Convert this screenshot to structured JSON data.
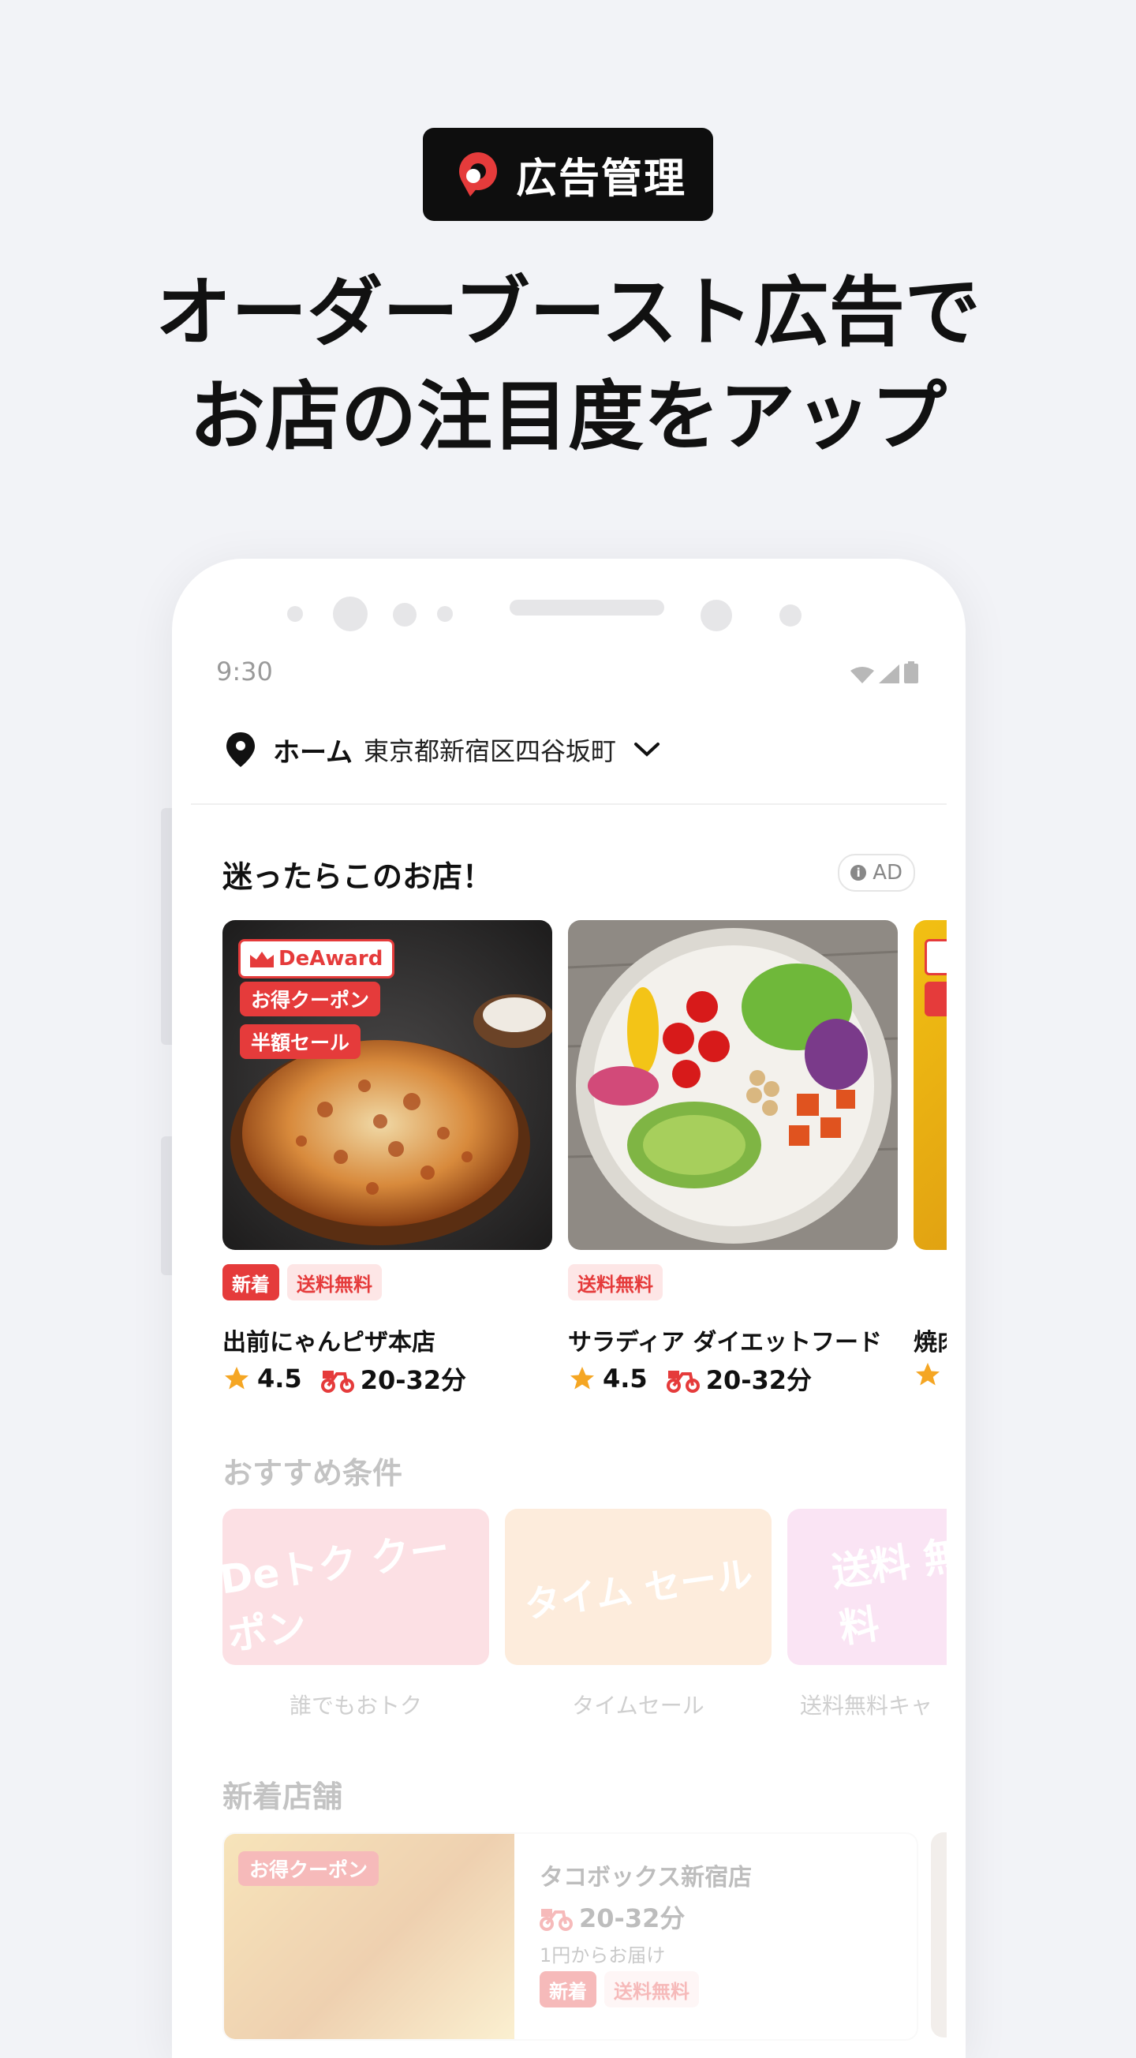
{
  "badge": {
    "label": "広告管理"
  },
  "headline": {
    "line1": "オーダーブースト広告で",
    "line2": "お店の注目度をアップ"
  },
  "status": {
    "time": "9:30"
  },
  "address": {
    "home": "ホーム",
    "text": "東京都新宿区四谷坂町"
  },
  "featured": {
    "title": "迷ったらこのお店！",
    "ad_label": "AD",
    "cards": [
      {
        "award": "DeAward",
        "tags": [
          "お得クーポン",
          "半額セール"
        ],
        "chips": [
          "新着",
          "送料無料"
        ],
        "name": "出前にゃんピザ本店",
        "rating": "4.5",
        "time": "20-32分"
      },
      {
        "chips": [
          "送料無料"
        ],
        "name": "サラディア ダイエットフード",
        "rating": "4.5",
        "time": "20-32分"
      },
      {
        "name": "焼肉"
      }
    ]
  },
  "recommend": {
    "title": "おすすめ条件",
    "items": [
      {
        "label": "誰でもおトク",
        "art": "Deトク クーポン",
        "color": "#f6a6b2"
      },
      {
        "label": "タイムセール",
        "art": "タイム セール",
        "color": "#f8c99a"
      },
      {
        "label": "送料無料キャ",
        "art": "送料 無料",
        "color": "#efb3df"
      }
    ]
  },
  "new_stores": {
    "title": "新着店舗",
    "card": {
      "coupon": "お得クーポン",
      "name": "タコボックス新宿店",
      "time": "20-32分",
      "sub": "1円からお届け",
      "chips": [
        "新着",
        "送料無料"
      ]
    }
  },
  "colors": {
    "accent": "#e53b3b",
    "star": "#f5a623"
  }
}
